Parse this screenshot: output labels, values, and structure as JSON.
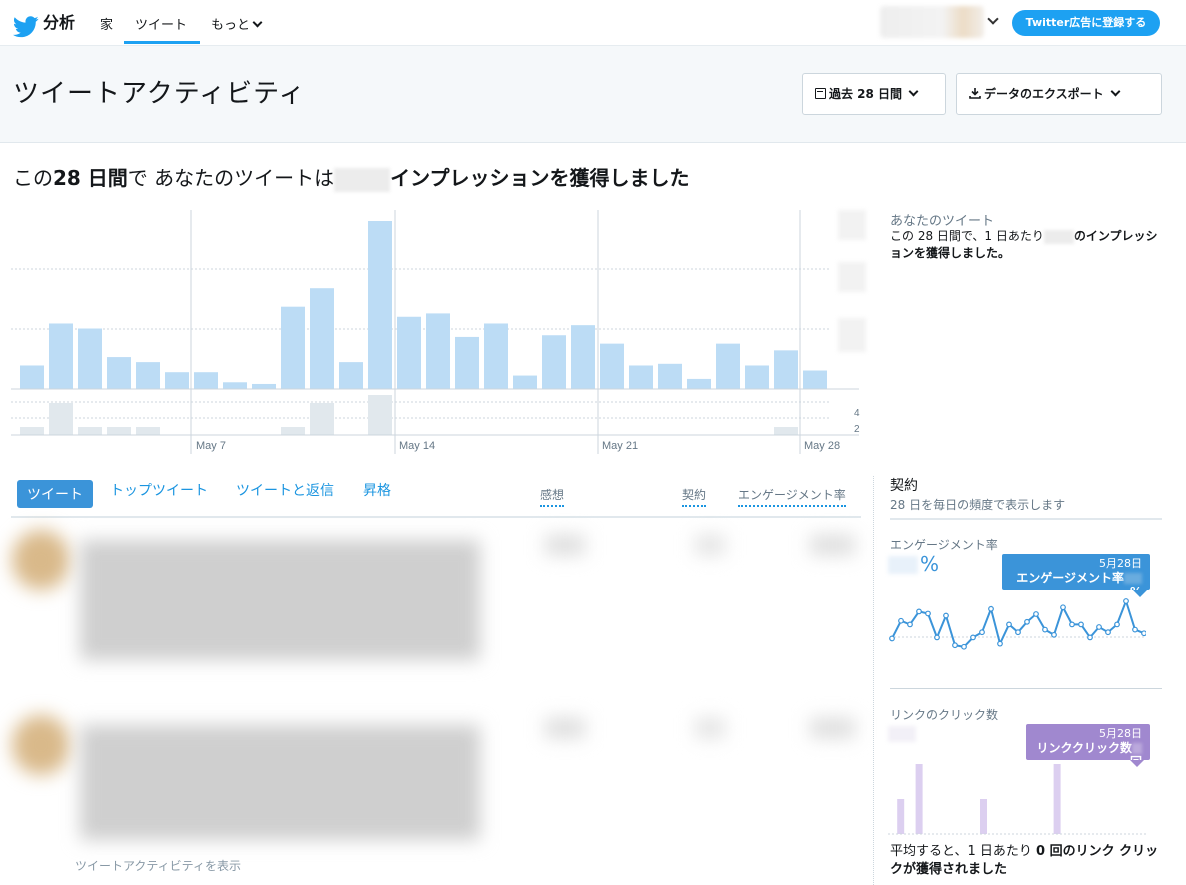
{
  "nav": {
    "brand": "分析",
    "links": [
      "家",
      "ツイート",
      "もっと"
    ],
    "ads_button": "Twitter広告に登録する"
  },
  "header": {
    "title": "ツイートアクティビティ",
    "period_button": "過去 28 日間",
    "export_button": "データのエクスポート"
  },
  "summary": {
    "prefix": "この",
    "period": "28 日間",
    "middle": "で あなたのツイートは",
    "suffix": "インプレッションを獲得しました"
  },
  "yours": {
    "title": "あなたのツイート",
    "text_a": "この 28 日間で、1 日あたり",
    "text_b": "のインプレッションを獲得しました。"
  },
  "chart_data": {
    "type": "bar",
    "x_ticks": [
      "May 7",
      "May 14",
      "May 21",
      "May 28"
    ],
    "impressions_relative": [
      0.14,
      0.39,
      0.36,
      0.19,
      0.16,
      0.1,
      0.1,
      0.04,
      0.03,
      0.49,
      0.6,
      0.16,
      1.0,
      0.43,
      0.45,
      0.31,
      0.39,
      0.08,
      0.32,
      0.38,
      0.27,
      0.14,
      0.15,
      0.06,
      0.27,
      0.14,
      0.23,
      0.11
    ],
    "tweets_per_day": [
      1,
      4,
      1,
      1,
      1,
      0,
      0,
      0,
      0,
      1,
      4,
      0,
      5,
      0,
      0,
      0,
      0,
      0,
      0,
      0,
      0,
      0,
      0,
      0,
      0,
      0,
      1,
      0
    ],
    "secondary_ticks": [
      "4",
      "2"
    ]
  },
  "tabs": [
    "ツイート",
    "トップツイート",
    "ツイートと返信",
    "昇格"
  ],
  "columns": [
    "感想",
    "契約",
    "エンゲージメント率"
  ],
  "show_more": "ツイートアクティビティを表示",
  "right": {
    "title": "契約",
    "subtitle": "28 日を毎日の頻度で表示します",
    "eng_label": "エンゲージメント率",
    "eng_pct_symbol": "%",
    "eng_tip_date": "5月28日",
    "eng_tip_label": "エンゲージメント率",
    "eng_tip_pct": "%",
    "eng_series": [
      0.28,
      0.62,
      0.55,
      0.8,
      0.76,
      0.3,
      0.72,
      0.15,
      0.12,
      0.3,
      0.4,
      0.85,
      0.18,
      0.55,
      0.4,
      0.6,
      0.75,
      0.45,
      0.35,
      0.88,
      0.55,
      0.55,
      0.3,
      0.5,
      0.4,
      0.55,
      1.0,
      0.45,
      0.38
    ],
    "link_label": "リンクのクリック数",
    "link_tip_date": "5月28日",
    "link_tip_label": "リンククリック数",
    "link_tip_suffix": "回",
    "link_series": [
      0,
      0.5,
      0,
      1.0,
      0,
      0,
      0,
      0,
      0,
      0,
      0.5,
      0,
      0,
      0,
      0,
      0,
      0,
      0,
      1.0,
      0,
      0,
      0,
      0,
      0,
      0,
      0,
      0,
      0
    ],
    "foot_a": "平均すると、1 日あたり ",
    "foot_b": "0 回のリンク クリックが獲得されました"
  },
  "colors": {
    "twitter_blue": "#1da1f2",
    "bar_blue": "#bcdcf5",
    "bar_grey": "#e1e8ed",
    "eng_line": "#3b94d9",
    "link_purple": "#a088cf"
  }
}
